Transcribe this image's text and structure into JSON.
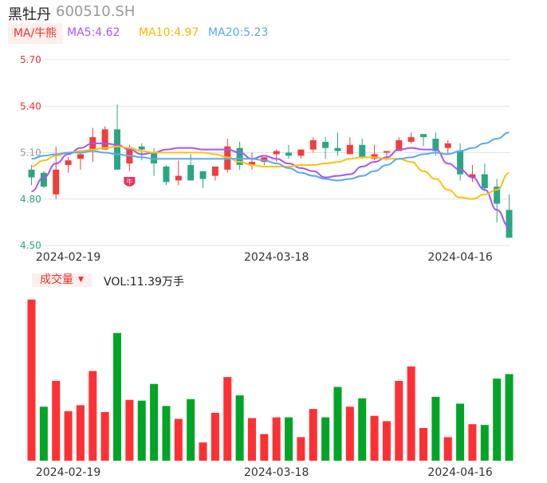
{
  "header": {
    "name": "黑牡丹",
    "code": "600510.SH"
  },
  "ma_legend": {
    "tag": "MA/牛熊",
    "ma5": "MA5:4.62",
    "ma10": "MA10:4.97",
    "ma20": "MA20:5.23"
  },
  "volume_legend": {
    "tag": "成交量",
    "dropdown_icon": "triangle-down",
    "value": "VOL:11.39万手"
  },
  "badge": {
    "icon": "bull-shield-icon",
    "text": "牛"
  },
  "colors": {
    "up": "#ee3e3e",
    "down": "#2ba683",
    "vol_up": "#ff3033",
    "vol_down": "#00a526",
    "ma5": "#a855f7",
    "ma10": "#ffc107",
    "ma20": "#5aa9f0",
    "grid": "#dde3ee"
  },
  "chart_data": [
    {
      "type": "candlestick",
      "title": "黑牡丹 600510.SH",
      "ylim": [
        4.5,
        5.7
      ],
      "yticks": [
        {
          "label": "5.70",
          "value": 5.7,
          "color": "#f0302f"
        },
        {
          "label": "5.40",
          "value": 5.4,
          "color": "#f0302f"
        },
        {
          "label": "5.10",
          "value": 5.1,
          "color": "#999999"
        },
        {
          "label": "4.80",
          "value": 4.8,
          "color": "#2ba683"
        },
        {
          "label": "4.50",
          "value": 4.5,
          "color": "#2ba683"
        }
      ],
      "xticks": [
        {
          "label": "2024-02-19",
          "index": 3
        },
        {
          "label": "2024-03-18",
          "index": 20
        },
        {
          "label": "2024-04-16",
          "index": 35
        }
      ],
      "grid": true,
      "ohlc": [
        [
          4.99,
          5.02,
          4.89,
          4.94
        ],
        [
          4.97,
          4.98,
          4.87,
          4.88
        ],
        [
          4.83,
          5.14,
          4.8,
          4.99
        ],
        [
          5.02,
          5.07,
          4.97,
          5.05
        ],
        [
          5.06,
          5.1,
          4.99,
          5.09
        ],
        [
          5.12,
          5.26,
          5.04,
          5.2
        ],
        [
          5.12,
          5.27,
          5.12,
          5.25
        ],
        [
          5.25,
          5.41,
          4.99,
          4.99
        ],
        [
          5.03,
          5.15,
          4.98,
          5.12
        ],
        [
          5.14,
          5.16,
          5.05,
          5.12
        ],
        [
          5.1,
          5.13,
          4.95,
          5.03
        ],
        [
          5.01,
          5.02,
          4.89,
          4.91
        ],
        [
          4.92,
          5.05,
          4.89,
          4.95
        ],
        [
          5.02,
          5.09,
          4.92,
          4.92
        ],
        [
          4.98,
          4.98,
          4.87,
          4.93
        ],
        [
          4.95,
          5.01,
          4.92,
          5.01
        ],
        [
          4.99,
          5.19,
          4.97,
          5.14
        ],
        [
          5.13,
          5.17,
          4.99,
          5.02
        ],
        [
          5.02,
          5.1,
          4.99,
          5.04
        ],
        [
          5.04,
          5.07,
          5.02,
          5.07
        ],
        [
          5.09,
          5.12,
          5.04,
          5.11
        ],
        [
          5.1,
          5.15,
          5.06,
          5.08
        ],
        [
          5.08,
          5.12,
          5.06,
          5.12
        ],
        [
          5.12,
          5.2,
          5.1,
          5.18
        ],
        [
          5.17,
          5.2,
          5.06,
          5.13
        ],
        [
          5.13,
          5.23,
          5.08,
          5.11
        ],
        [
          5.09,
          5.2,
          5.09,
          5.15
        ],
        [
          5.15,
          5.19,
          5.06,
          5.07
        ],
        [
          5.06,
          5.15,
          5.05,
          5.09
        ],
        [
          5.1,
          5.11,
          5.05,
          5.11
        ],
        [
          5.11,
          5.2,
          5.11,
          5.18
        ],
        [
          5.17,
          5.23,
          5.16,
          5.2
        ],
        [
          5.22,
          5.22,
          5.14,
          5.2
        ],
        [
          5.19,
          5.23,
          5.08,
          5.11
        ],
        [
          5.13,
          5.18,
          5.09,
          5.16
        ],
        [
          5.11,
          5.16,
          4.92,
          4.96
        ],
        [
          4.94,
          5.02,
          4.91,
          4.96
        ],
        [
          4.96,
          5.03,
          4.85,
          4.87
        ],
        [
          4.88,
          4.93,
          4.65,
          4.77
        ],
        [
          4.73,
          4.83,
          4.55,
          4.55
        ]
      ],
      "ohlc_fields": [
        "open",
        "high",
        "low",
        "close"
      ],
      "series": [
        {
          "name": "MA5",
          "values": [
            4.85,
            4.94,
            5.03,
            5.09,
            5.13,
            5.16,
            5.16,
            5.15,
            5.12,
            5.09,
            5.1,
            5.12,
            5.13,
            5.13,
            5.12,
            5.12,
            5.12,
            5.1,
            5.06,
            5.08,
            5.06,
            5.03,
            5.0,
            4.98,
            4.94,
            4.95,
            4.96,
            5.01,
            5.04,
            5.07,
            5.12,
            5.13,
            5.12,
            5.12,
            5.03,
            4.99,
            4.94,
            4.86,
            4.73,
            4.62
          ]
        },
        {
          "name": "MA10",
          "values": [
            5.01,
            5.05,
            5.08,
            5.1,
            5.11,
            5.12,
            5.13,
            5.14,
            5.13,
            5.11,
            5.1,
            5.1,
            5.1,
            5.1,
            5.1,
            5.09,
            5.07,
            5.04,
            5.02,
            5.01,
            5.01,
            5.01,
            5.02,
            5.02,
            5.03,
            5.04,
            5.06,
            5.07,
            5.07,
            5.06,
            5.06,
            5.04,
            4.98,
            4.93,
            4.86,
            4.81,
            4.8,
            4.83,
            4.86,
            4.97
          ]
        },
        {
          "name": "MA20",
          "values": [
            5.06,
            5.08,
            5.09,
            5.1,
            5.1,
            5.11,
            5.1,
            5.09,
            5.08,
            5.07,
            5.06,
            5.06,
            5.06,
            5.06,
            5.06,
            5.06,
            5.06,
            5.06,
            5.06,
            5.05,
            5.03,
            5.0,
            4.97,
            4.95,
            4.93,
            4.92,
            4.93,
            4.95,
            4.98,
            5.02,
            5.06,
            5.07,
            5.09,
            5.1,
            5.09,
            5.11,
            5.13,
            5.16,
            5.19,
            5.23
          ]
        }
      ],
      "badge_index": 8
    },
    {
      "type": "bar",
      "title": "成交量",
      "ylabel": "万手",
      "ylim": [
        0,
        21.5
      ],
      "xticks": [
        {
          "label": "2024-02-19",
          "index": 3
        },
        {
          "label": "2024-03-18",
          "index": 20
        },
        {
          "label": "2024-04-16",
          "index": 35
        }
      ],
      "values": [
        21.2,
        7.1,
        10.5,
        6.5,
        7.3,
        11.8,
        6.4,
        16.8,
        8.0,
        7.9,
        10.1,
        7.2,
        5.5,
        8.1,
        2.4,
        6.3,
        11.0,
        8.6,
        5.6,
        3.5,
        5.7,
        5.7,
        3.1,
        6.8,
        5.7,
        9.7,
        7.1,
        8.2,
        5.9,
        5.2,
        10.5,
        12.4,
        4.3,
        8.4,
        3.1,
        7.5,
        4.8,
        4.7,
        10.8,
        11.39
      ],
      "directions": [
        "up",
        "down",
        "up",
        "up",
        "up",
        "up",
        "up",
        "down",
        "up",
        "down",
        "down",
        "down",
        "up",
        "down",
        "up",
        "up",
        "up",
        "down",
        "up",
        "up",
        "up",
        "down",
        "up",
        "up",
        "down",
        "down",
        "up",
        "down",
        "up",
        "up",
        "up",
        "up",
        "up",
        "down",
        "up",
        "down",
        "up",
        "down",
        "down",
        "down"
      ]
    }
  ]
}
